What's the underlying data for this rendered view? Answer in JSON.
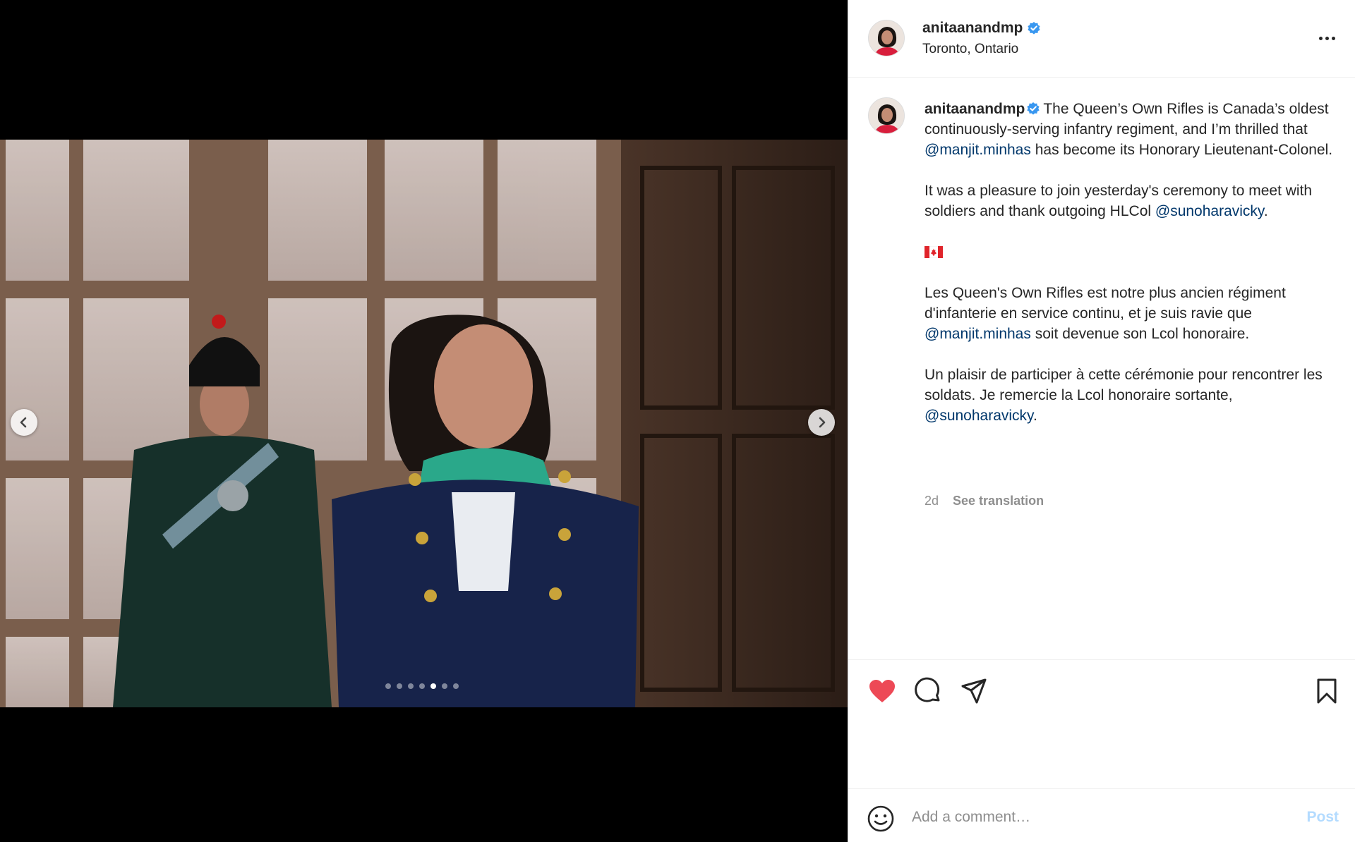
{
  "post": {
    "username": "anitaanandmp",
    "location": "Toronto, Ontario",
    "verified_icon": "verified-badge-icon",
    "more_icon": "more-horizontal-icon"
  },
  "carousel": {
    "slide_count": 7,
    "active_index": 4,
    "prev_icon": "chevron-left-icon",
    "next_icon": "chevron-right-icon"
  },
  "caption": {
    "username": "anitaanandmp",
    "p1_a": "The Queen’s Own Rifles is Canada’s oldest continuously-serving infantry regiment, and I’m thrilled that ",
    "p1_mention": "@manjit.minhas",
    "p1_b": " has become its Honorary Lieutenant-Colonel.",
    "p2_a": "It was a pleasure to join yesterday's ceremony to meet with soldiers and thank outgoing HLCol ",
    "p2_mention": "@sunoharavicky",
    "p2_b": ".",
    "flag": "canada-flag",
    "p3_a": "Les Queen's Own Rifles est notre plus ancien régiment d'infanterie en service continu, et je suis ravie que ",
    "p3_mention": "@manjit.minhas",
    "p3_b": " soit devenue son Lcol honoraire.",
    "p4_a": "Un plaisir de participer à cette cérémonie pour rencontrer les soldats. Je remercie la Lcol honoraire sortante, ",
    "p4_mention": "@sunoharavicky",
    "p4_b": "."
  },
  "meta": {
    "time_ago": "2d",
    "see_translation": "See translation"
  },
  "actions": {
    "like_icon": "heart-filled-icon",
    "comment_icon": "comment-icon",
    "share_icon": "paper-plane-icon",
    "save_icon": "bookmark-icon",
    "liked_color": "#ed4956"
  },
  "comment_bar": {
    "emoji_icon": "emoji-smile-icon",
    "placeholder": "Add a comment…",
    "post_label": "Post",
    "post_color": "#b3dbff"
  },
  "colors": {
    "mention": "#00376b",
    "secondary_text": "#8e8e8e",
    "verified": "#3897f0"
  }
}
